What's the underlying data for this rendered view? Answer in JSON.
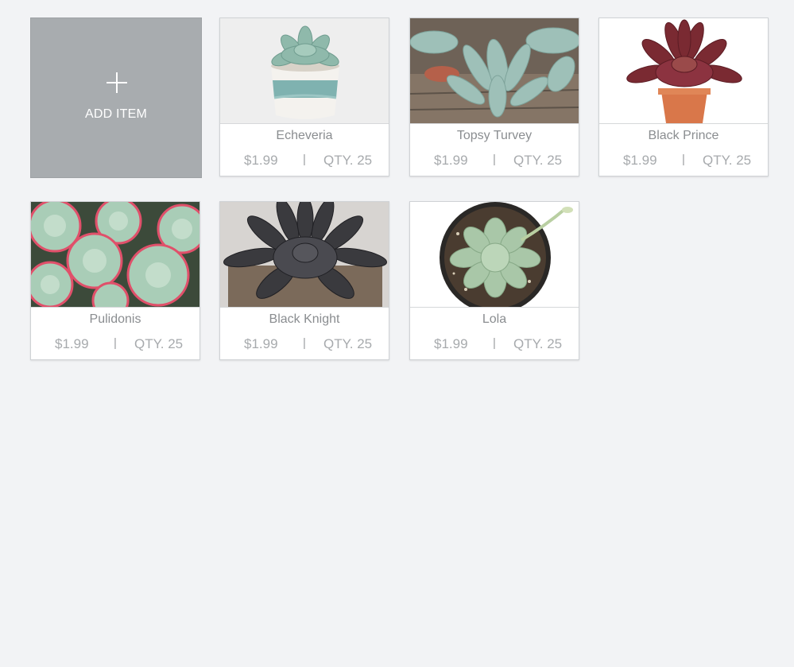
{
  "add_item": {
    "label": "ADD ITEM",
    "icon": "plus-icon"
  },
  "products": [
    {
      "name": "Echeveria",
      "price": "$1.99",
      "separator": "|",
      "qty": "QTY. 25",
      "image": "echeveria-potted-photo"
    },
    {
      "name": "Topsy Turvey",
      "price": "$1.99",
      "separator": "|",
      "qty": "QTY. 25",
      "image": "topsy-turvey-photo"
    },
    {
      "name": "Black Prince",
      "price": "$1.99",
      "separator": "|",
      "qty": "QTY. 25",
      "image": "black-prince-photo"
    },
    {
      "name": "Pulidonis",
      "price": "$1.99",
      "separator": "|",
      "qty": "QTY. 25",
      "image": "pulidonis-photo"
    },
    {
      "name": "Black Knight",
      "price": "$1.99",
      "separator": "|",
      "qty": "QTY. 25",
      "image": "black-knight-photo"
    },
    {
      "name": "Lola",
      "price": "$1.99",
      "separator": "|",
      "qty": "QTY. 25",
      "image": "lola-photo"
    }
  ]
}
